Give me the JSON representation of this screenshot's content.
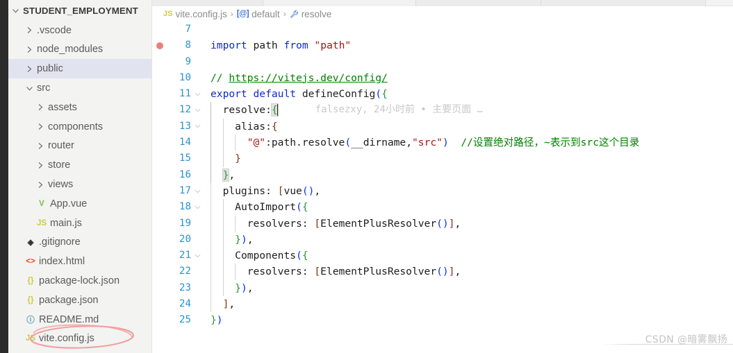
{
  "sidebar": {
    "root": {
      "label": "STUDENT_EMPLOYMENT",
      "icon": "chevron-down-icon"
    },
    "items": [
      {
        "label": ".vscode",
        "icon": "chevron-right-icon",
        "type": "folder",
        "depth": 1,
        "selected": false
      },
      {
        "label": "node_modules",
        "icon": "chevron-right-icon",
        "type": "folder",
        "depth": 1,
        "selected": false
      },
      {
        "label": "public",
        "icon": "chevron-right-icon",
        "type": "folder",
        "depth": 1,
        "selected": true
      },
      {
        "label": "src",
        "icon": "chevron-down-icon",
        "type": "folder",
        "depth": 1,
        "selected": false
      },
      {
        "label": "assets",
        "icon": "chevron-right-icon",
        "type": "folder",
        "depth": 2,
        "selected": false
      },
      {
        "label": "components",
        "icon": "chevron-right-icon",
        "type": "folder",
        "depth": 2,
        "selected": false
      },
      {
        "label": "router",
        "icon": "chevron-right-icon",
        "type": "folder",
        "depth": 2,
        "selected": false
      },
      {
        "label": "store",
        "icon": "chevron-right-icon",
        "type": "folder",
        "depth": 2,
        "selected": false
      },
      {
        "label": "views",
        "icon": "chevron-right-icon",
        "type": "folder",
        "depth": 2,
        "selected": false
      },
      {
        "label": "App.vue",
        "icon": "vue-file-icon",
        "type": "file",
        "depth": 2,
        "glyph": "V",
        "cls": "ico-vue"
      },
      {
        "label": "main.js",
        "icon": "js-file-icon",
        "type": "file",
        "depth": 2,
        "glyph": "JS",
        "cls": "ico-js"
      },
      {
        "label": ".gitignore",
        "icon": "git-file-icon",
        "type": "file",
        "depth": 1,
        "glyph": "◈",
        "cls": "ico-git"
      },
      {
        "label": "index.html",
        "icon": "html-file-icon",
        "type": "file",
        "depth": 1,
        "glyph": "<>",
        "cls": "ico-html"
      },
      {
        "label": "package-lock.json",
        "icon": "json-file-icon",
        "type": "file",
        "depth": 1,
        "glyph": "{}",
        "cls": "ico-json"
      },
      {
        "label": "package.json",
        "icon": "json-file-icon",
        "type": "file",
        "depth": 1,
        "glyph": "{}",
        "cls": "ico-json"
      },
      {
        "label": "README.md",
        "icon": "info-file-icon",
        "type": "file",
        "depth": 1,
        "glyph": "ⓘ",
        "cls": "ico-md"
      },
      {
        "label": "vite.config.js",
        "icon": "js-file-icon",
        "type": "file",
        "depth": 1,
        "glyph": "JS",
        "cls": "ico-js",
        "annotated": true
      }
    ],
    "annotation_color": "#f0a0a0"
  },
  "breadcrumb": {
    "file": "vite.config.js",
    "file_icon": "js-file-icon",
    "file_icon_glyph": "JS",
    "symbol1": "default",
    "symbol1_icon": "module-export-icon",
    "symbol1_glyph": "[@]",
    "symbol2": "resolve",
    "symbol2_icon": "wrench-property-icon",
    "symbol2_glyph": "🔧",
    "separator": "›"
  },
  "editor": {
    "blame": "falsezxy, 24小时前 • 主要页面 …",
    "breakpoint_line": 8,
    "cursor_line": 12,
    "lines": [
      {
        "n": 7,
        "text": ""
      },
      {
        "n": 8,
        "text": "import path from \"path\""
      },
      {
        "n": 9,
        "text": ""
      },
      {
        "n": 10,
        "text": "// https://vitejs.dev/config/"
      },
      {
        "n": 11,
        "text": "export default defineConfig({"
      },
      {
        "n": 12,
        "text": "  resolve:{"
      },
      {
        "n": 13,
        "text": "    alias:{"
      },
      {
        "n": 14,
        "text": "      \"@\":path.resolve(__dirname,\"src\")  //设置绝对路径，~表示到src这个目录"
      },
      {
        "n": 15,
        "text": "    }"
      },
      {
        "n": 16,
        "text": "  },"
      },
      {
        "n": 17,
        "text": "  plugins: [vue(),"
      },
      {
        "n": 18,
        "text": "    AutoImport({"
      },
      {
        "n": 19,
        "text": "      resolvers: [ElementPlusResolver()],"
      },
      {
        "n": 20,
        "text": "    }),"
      },
      {
        "n": 21,
        "text": "    Components({"
      },
      {
        "n": 22,
        "text": "      resolvers: [ElementPlusResolver()],"
      },
      {
        "n": 23,
        "text": "    }),"
      },
      {
        "n": 24,
        "text": "  ],"
      },
      {
        "n": 25,
        "text": "})"
      }
    ],
    "code_comment_inline": "//设置绝对路径，~表示到src这个目录",
    "code_comment_url": "// https://vitejs.dev/config/"
  },
  "watermark": {
    "text": "CSDN @暗雾飘扬"
  },
  "colors": {
    "activity_bar": "#2c2c2c",
    "sidebar_bg": "#f3f3f2",
    "selection": "#e1e4ef",
    "editor_bg": "#ffffff",
    "line_number": "#2b91cf",
    "keyword": "#0f29c8",
    "string": "#a31515",
    "comment": "#008000",
    "function": "#795e26",
    "breakpoint": "#e98080",
    "annotation": "#f0a0a0"
  }
}
